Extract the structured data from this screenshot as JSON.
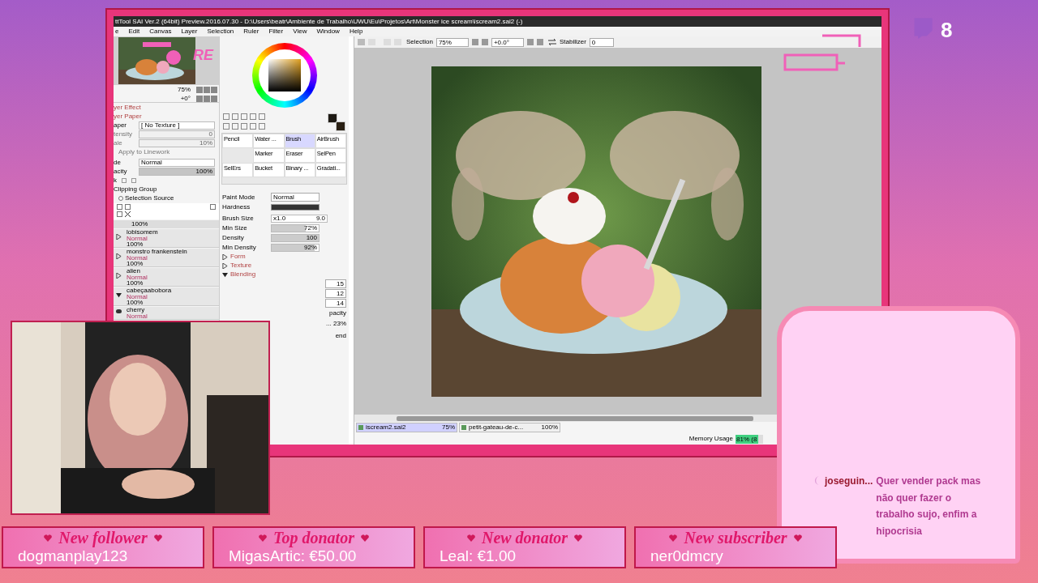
{
  "stream": {
    "viewer_count": "8"
  },
  "app": {
    "title": "ttTool SAI Ver.2 (64bit) Preview.2016.07.30 - D:\\Users\\beatr\\Ambiente de Trabalho\\UWU\\Eu\\Projetos\\Art\\Monster ice scream\\iscream2.sai2 (-)",
    "menu": [
      "e",
      "Edit",
      "Canvas",
      "Layer",
      "Selection",
      "Ruler",
      "Filter",
      "View",
      "Window",
      "Help"
    ],
    "toolbar": {
      "selection_label": "Selection",
      "zoom": "75%",
      "angle": "+0.0°",
      "stabilizer_label": "Stabilizer",
      "stabilizer": "0"
    },
    "navigator": {
      "zoom": "75%",
      "angle": "+0°",
      "overlay_text": "RE"
    },
    "layer_effects": [
      "yer Effect",
      "yer Paper"
    ],
    "fields": [
      {
        "label": "aper",
        "value": "[ No Texture ]",
        "disabled": false
      },
      {
        "label": "tensity",
        "value": "0",
        "disabled": true
      },
      {
        "label": "ale",
        "value": "10%",
        "disabled": true
      }
    ],
    "apply_linework": "Apply to Linework",
    "blend_mode": {
      "label": "de",
      "value": "Normal"
    },
    "opacity": {
      "label": "acity",
      "value": "100%",
      "level": 1
    },
    "lock_label": "k",
    "clipping": {
      "label": "Clipping Group",
      "checked": false
    },
    "selection_source": {
      "label": "Selection Source",
      "checked": false
    },
    "folder_opacity": "100%",
    "layers": [
      {
        "name": "lobisomem",
        "mode": "Normal",
        "opacity": "100%",
        "expanded": false
      },
      {
        "name": "monstro frankenstein",
        "mode": "Normal",
        "opacity": "100%",
        "expanded": false
      },
      {
        "name": "alien",
        "mode": "Normal",
        "opacity": "100%",
        "expanded": false
      },
      {
        "name": "cabeçaabobora",
        "mode": "Normal",
        "opacity": "100%",
        "expanded": true
      },
      {
        "name": "cherry",
        "mode": "Normal",
        "kind": "layer"
      }
    ],
    "tools": [
      {
        "kind": "tool",
        "label": "Pencil",
        "selected": false
      },
      {
        "kind": "tool",
        "label": "Water ...",
        "selected": false
      },
      {
        "kind": "tool",
        "label": "Brush",
        "selected": true
      },
      {
        "kind": "tool",
        "label": "AirBrush",
        "selected": false
      },
      {
        "kind": "blank"
      },
      {
        "kind": "tool",
        "label": "Marker",
        "selected": false
      },
      {
        "kind": "tool",
        "label": "Eraser",
        "selected": false
      },
      {
        "kind": "tool",
        "label": "SelPen",
        "selected": false
      },
      {
        "kind": "tool",
        "label": "SelErs",
        "selected": false
      },
      {
        "kind": "tool",
        "label": "Bucket",
        "selected": false
      },
      {
        "kind": "tool",
        "label": "Binary ...",
        "selected": false
      },
      {
        "kind": "tool",
        "label": "Gradati...",
        "selected": false
      }
    ],
    "brush": {
      "paint_mode_label": "Paint Mode",
      "paint_mode": "Normal",
      "hardness_label": "Hardness",
      "size_label": "Brush Size",
      "size_mult": "x1.0",
      "size": "9.0",
      "sliders": [
        {
          "label": "Min Size",
          "value": "72%",
          "level": 0.72
        },
        {
          "label": "Density",
          "value": "100",
          "level": 1
        },
        {
          "label": "Min Density",
          "value": "92%",
          "level": 0.92
        }
      ],
      "sections": [
        {
          "label": "Form",
          "expanded": false
        },
        {
          "label": "Texture",
          "expanded": false
        },
        {
          "label": "Blending",
          "expanded": true
        }
      ],
      "blending_values": [
        "15",
        "12",
        "14"
      ],
      "opacity_label": "pacity",
      "opacity_value": "... 23%",
      "blend_label": "end"
    },
    "tabs": [
      {
        "name": "iscream2.sai2",
        "zoom": "75%",
        "selected": true
      },
      {
        "name": "petit-gateau-de-c...",
        "zoom": "100%",
        "selected": false
      }
    ],
    "status": {
      "memory_label": "Memory Usage",
      "memory_value": "81% (8",
      "level": 0.81
    }
  },
  "chat": {
    "user": "joseguin...",
    "message": "Quer vender pack mas não quer fazer o trabalho sujo, enfim a hipocrisia"
  },
  "alerts": [
    {
      "title": "New follower",
      "value": "dogmanplay123"
    },
    {
      "title": "Top donator",
      "value": "MigasArtic: €50.00"
    },
    {
      "title": "New donator",
      "value": "Leal: €1.00"
    },
    {
      "title": "New subscriber",
      "value": "ner0dmcry"
    }
  ]
}
